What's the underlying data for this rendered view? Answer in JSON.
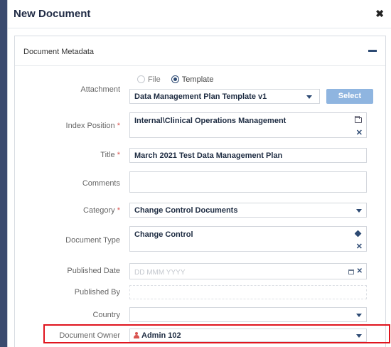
{
  "modal": {
    "title": "New Document"
  },
  "panel": {
    "title": "Document Metadata"
  },
  "form": {
    "attachment": {
      "label": "Attachment",
      "options": [
        "File",
        "Template"
      ],
      "selected": "Template",
      "value": "Data Management Plan Template v1",
      "button_label": "Select"
    },
    "index_position": {
      "label": "Index Position",
      "required": "*",
      "value": "Internal\\Clinical Operations Management"
    },
    "title": {
      "label": "Title",
      "required": "*",
      "value": "March 2021 Test Data Management Plan"
    },
    "comments": {
      "label": "Comments",
      "value": ""
    },
    "category": {
      "label": "Category",
      "required": "*",
      "value": "Change Control Documents"
    },
    "document_type": {
      "label": "Document Type",
      "value": "Change Control"
    },
    "published_date": {
      "label": "Published Date",
      "placeholder": "DD MMM YYYY"
    },
    "published_by": {
      "label": "Published By",
      "value": ""
    },
    "country": {
      "label": "Country",
      "value": ""
    },
    "document_owner": {
      "label": "Document Owner",
      "value": "Admin 102"
    }
  },
  "colors": {
    "accent": "#2d4a73",
    "button": "#8fb5e0",
    "required": "#d9534f",
    "highlight": "#e0141e"
  },
  "icons": {
    "close": "close-icon",
    "collapse": "minus-icon",
    "folder": "folder-icon",
    "tag": "tag-icon",
    "calendar": "calendar-icon",
    "user": "user-icon"
  }
}
